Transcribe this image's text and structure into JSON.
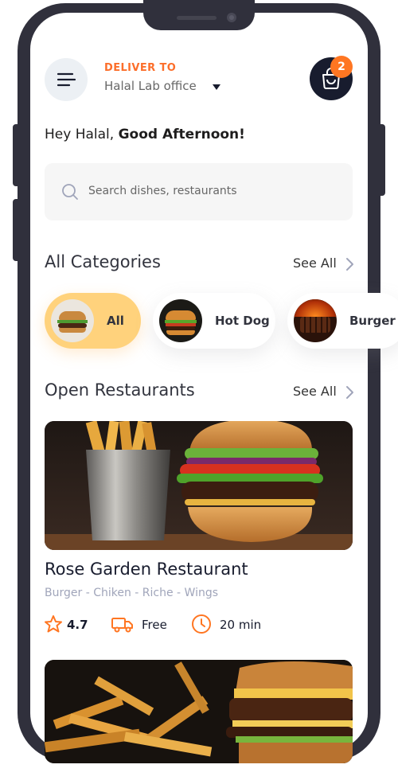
{
  "header": {
    "deliver_label": "DELIVER TO",
    "address": "Halal Lab office",
    "cart_count": "2"
  },
  "greeting": {
    "prefix": "Hey Halal, ",
    "emphasis": "Good Afternoon!"
  },
  "search": {
    "placeholder": "Search dishes, restaurants"
  },
  "categories": {
    "title": "All Categories",
    "see_all": "See All",
    "items": [
      {
        "label": "All",
        "selected": true
      },
      {
        "label": "Hot Dog",
        "selected": false
      },
      {
        "label": "Burger",
        "selected": false
      }
    ]
  },
  "restaurants": {
    "title": "Open Restaurants",
    "see_all": "See All",
    "items": [
      {
        "name": "Rose Garden Restaurant",
        "tags": "Burger - Chiken - Riche - Wings",
        "rating": "4.7",
        "delivery": "Free",
        "time": "20 min"
      }
    ]
  },
  "colors": {
    "accent": "#fc6e2a",
    "selected_pill": "#ffd27c",
    "dark": "#181c2e"
  }
}
